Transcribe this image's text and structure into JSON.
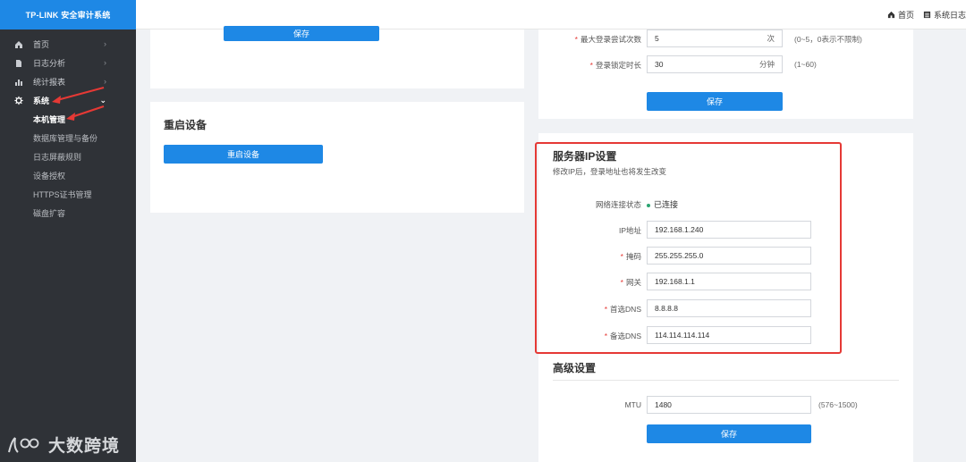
{
  "brand": {
    "title": "TP-LINK 安全审计系统"
  },
  "topbar": {
    "home": "首页",
    "syslog": "系统日志"
  },
  "sidebar": {
    "items": [
      {
        "label": "首页",
        "icon": "home-icon"
      },
      {
        "label": "日志分析",
        "icon": "document-icon"
      },
      {
        "label": "统计报表",
        "icon": "bar-chart-icon"
      },
      {
        "label": "系统",
        "icon": "gear-icon"
      }
    ],
    "submenu": [
      {
        "label": "本机管理"
      },
      {
        "label": "数据库管理与备份"
      },
      {
        "label": "日志屏蔽规则"
      },
      {
        "label": "设备授权"
      },
      {
        "label": "HTTPS证书管理"
      },
      {
        "label": "磁盘扩容"
      }
    ],
    "watermark": "大数跨境"
  },
  "left_top_card": {
    "save_label": "保存"
  },
  "restart_card": {
    "title": "重启设备",
    "button_label": "重启设备"
  },
  "login_card": {
    "max_attempts_label": "最大登录尝试次数",
    "max_attempts_value": "5",
    "max_attempts_unit": "次",
    "max_attempts_hint": "(0~5，0表示不限制)",
    "lock_label": "登录锁定时长",
    "lock_value": "30",
    "lock_unit": "分钟",
    "lock_hint": "(1~60)",
    "save_label": "保存"
  },
  "ip_card": {
    "title": "服务器IP设置",
    "subtitle": "修改IP后，登录地址也将发生改变",
    "status_label": "网络连接状态",
    "status_value": "已连接",
    "ip_label": "IP地址",
    "ip_value": "192.168.1.240",
    "mask_label": "掩码",
    "mask_value": "255.255.255.0",
    "gateway_label": "网关",
    "gateway_value": "192.168.1.1",
    "dns1_label": "首选DNS",
    "dns1_value": "8.8.8.8",
    "dns2_label": "备选DNS",
    "dns2_value": "114.114.114.114"
  },
  "advanced": {
    "title": "高级设置",
    "mtu_label": "MTU",
    "mtu_value": "1480",
    "mtu_hint": "(576~1500)",
    "save_label": "保存"
  },
  "colors": {
    "accent": "#1e88e5",
    "sidebar": "#2f3237",
    "highlight": "#e53935"
  }
}
